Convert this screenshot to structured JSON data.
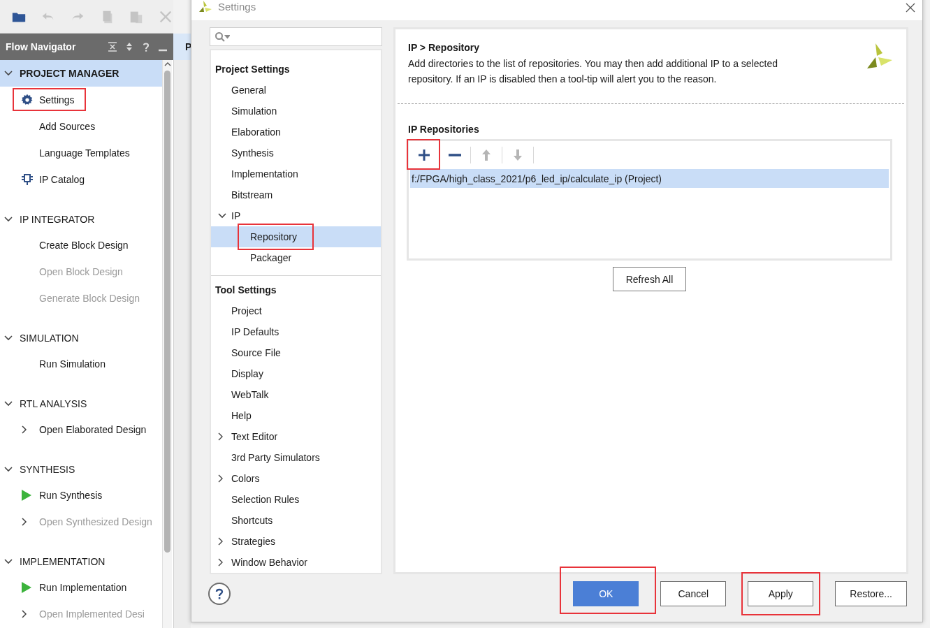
{
  "toolbar": {
    "buttons": [
      {
        "kind": "folder",
        "disabled": false
      },
      {
        "kind": "undo",
        "disabled": true
      },
      {
        "kind": "redo",
        "disabled": true
      },
      {
        "kind": "copy",
        "disabled": true
      },
      {
        "kind": "paste",
        "disabled": true
      },
      {
        "kind": "close",
        "disabled": true
      }
    ]
  },
  "flow_navigator": {
    "title": "Flow Navigator",
    "sections": [
      {
        "label": "PROJECT MANAGER",
        "expanded": true,
        "selected": true,
        "items": [
          {
            "label": "Settings",
            "kind": "gear",
            "disabled": false,
            "highlighted": true
          },
          {
            "label": "Add Sources",
            "kind": "plain",
            "disabled": false,
            "highlighted": false
          },
          {
            "label": "Language Templates",
            "kind": "plain",
            "disabled": false,
            "highlighted": false
          },
          {
            "label": "IP Catalog",
            "kind": "chip",
            "disabled": false,
            "highlighted": false
          }
        ]
      },
      {
        "label": "IP INTEGRATOR",
        "expanded": true,
        "selected": false,
        "items": [
          {
            "label": "Create Block Design",
            "kind": "plain",
            "disabled": false,
            "highlighted": false
          },
          {
            "label": "Open Block Design",
            "kind": "plain",
            "disabled": true,
            "highlighted": false
          },
          {
            "label": "Generate Block Design",
            "kind": "plain",
            "disabled": true,
            "highlighted": false
          }
        ]
      },
      {
        "label": "SIMULATION",
        "expanded": true,
        "selected": false,
        "items": [
          {
            "label": "Run Simulation",
            "kind": "plain",
            "disabled": false,
            "highlighted": false
          }
        ]
      },
      {
        "label": "RTL ANALYSIS",
        "expanded": true,
        "selected": false,
        "items": [
          {
            "label": "Open Elaborated Design",
            "kind": "expandable",
            "disabled": false,
            "highlighted": false
          }
        ]
      },
      {
        "label": "SYNTHESIS",
        "expanded": true,
        "selected": false,
        "items": [
          {
            "label": "Run Synthesis",
            "kind": "run",
            "disabled": false,
            "highlighted": false
          },
          {
            "label": "Open Synthesized Design",
            "kind": "expandable",
            "disabled": true,
            "highlighted": false
          }
        ]
      },
      {
        "label": "IMPLEMENTATION",
        "expanded": true,
        "selected": false,
        "items": [
          {
            "label": "Run Implementation",
            "kind": "run",
            "disabled": false,
            "highlighted": false
          },
          {
            "label": "Open Implemented Desi",
            "kind": "expandable",
            "disabled": true,
            "highlighted": false
          }
        ]
      }
    ]
  },
  "background_tab": {
    "label": "P"
  },
  "dialog": {
    "title": "Settings",
    "tree": {
      "groups": [
        {
          "label": "Project Settings",
          "items": [
            {
              "label": "General",
              "selected": false,
              "highlighted": false
            },
            {
              "label": "Simulation",
              "selected": false,
              "highlighted": false
            },
            {
              "label": "Elaboration",
              "selected": false,
              "highlighted": false
            },
            {
              "label": "Synthesis",
              "selected": false,
              "highlighted": false
            },
            {
              "label": "Implementation",
              "selected": false,
              "highlighted": false
            },
            {
              "label": "Bitstream",
              "selected": false,
              "highlighted": false
            },
            {
              "label": "IP",
              "selected": false,
              "highlighted": false,
              "expanded": true,
              "children": [
                {
                  "label": "Repository",
                  "selected": true,
                  "highlighted": true
                },
                {
                  "label": "Packager",
                  "selected": false,
                  "highlighted": false
                }
              ]
            }
          ]
        },
        {
          "label": "Tool Settings",
          "items": [
            {
              "label": "Project",
              "selected": false,
              "highlighted": false
            },
            {
              "label": "IP Defaults",
              "selected": false,
              "highlighted": false
            },
            {
              "label": "Source File",
              "selected": false,
              "highlighted": false
            },
            {
              "label": "Display",
              "selected": false,
              "highlighted": false
            },
            {
              "label": "WebTalk",
              "selected": false,
              "highlighted": false
            },
            {
              "label": "Help",
              "selected": false,
              "highlighted": false
            },
            {
              "label": "Text Editor",
              "selected": false,
              "highlighted": false,
              "expanded": false
            },
            {
              "label": "3rd Party Simulators",
              "selected": false,
              "highlighted": false
            },
            {
              "label": "Colors",
              "selected": false,
              "highlighted": false,
              "expanded": false
            },
            {
              "label": "Selection Rules",
              "selected": false,
              "highlighted": false
            },
            {
              "label": "Shortcuts",
              "selected": false,
              "highlighted": false
            },
            {
              "label": "Strategies",
              "selected": false,
              "highlighted": false,
              "expanded": false
            },
            {
              "label": "Window Behavior",
              "selected": false,
              "highlighted": false,
              "expanded": false
            }
          ]
        }
      ]
    },
    "page": {
      "heading": "IP > Repository",
      "description": "Add directories to the list of repositories. You may then add additional IP to a selected repository. If an IP is disabled then a tool-tip will alert you to the reason.",
      "repositories": {
        "title": "IP Repositories",
        "tools": [
          {
            "kind": "add",
            "disabled": false,
            "highlighted": true
          },
          {
            "kind": "remove",
            "disabled": false,
            "highlighted": false
          },
          {
            "kind": "up",
            "disabled": true,
            "highlighted": false
          },
          {
            "kind": "down",
            "disabled": true,
            "highlighted": false
          }
        ],
        "rows": [
          {
            "path": "f:/FPGA/high_class_2021/p6_led_ip/calculate_ip (Project)",
            "selected": true
          }
        ]
      },
      "refresh_button": "Refresh All"
    },
    "buttons": [
      {
        "label": "OK",
        "kind": "primary",
        "highlighted": true
      },
      {
        "label": "Cancel",
        "kind": "normal",
        "highlighted": false
      },
      {
        "label": "Apply",
        "kind": "normal",
        "highlighted": true
      },
      {
        "label": "Restore...",
        "kind": "normal",
        "highlighted": false
      }
    ]
  }
}
